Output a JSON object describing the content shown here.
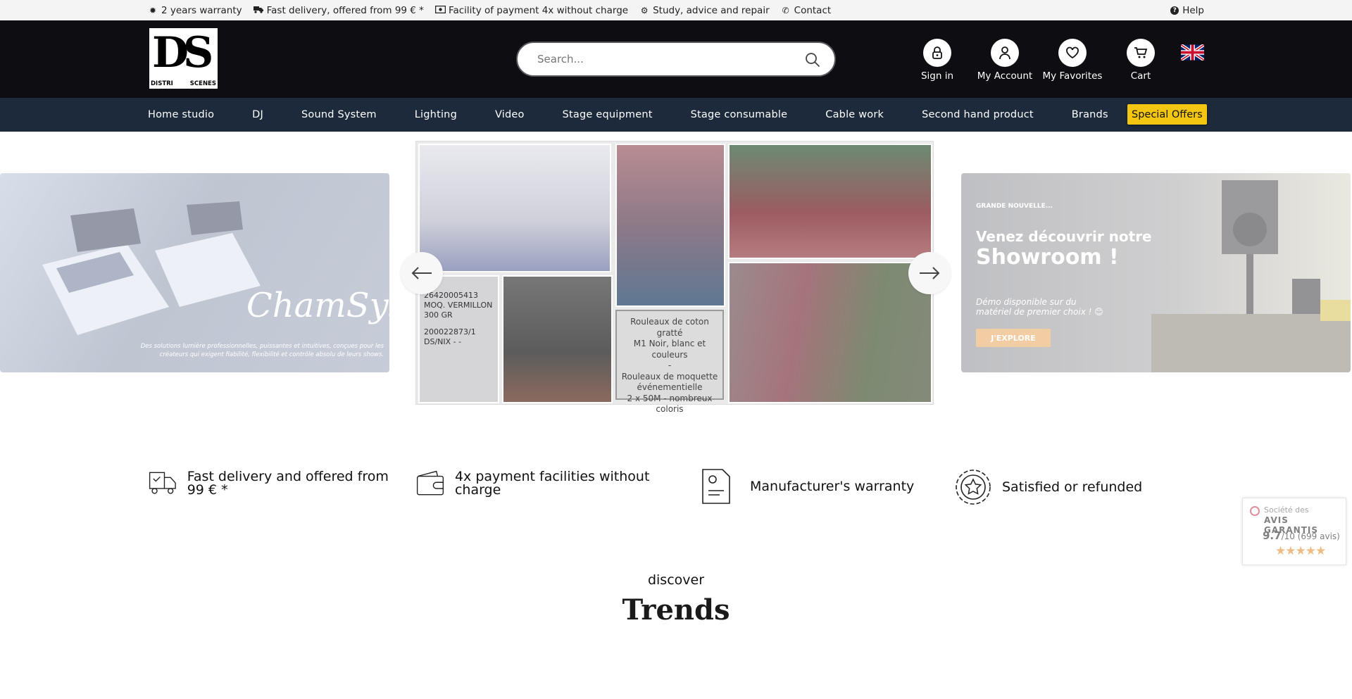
{
  "topbar": {
    "items": [
      {
        "icon": "badge-icon",
        "label": "2 years warranty"
      },
      {
        "icon": "truck-icon",
        "label": "Fast delivery, offered from 99 € *"
      },
      {
        "icon": "money-icon",
        "label": "Facility of payment 4x without charge"
      },
      {
        "icon": "gears-icon",
        "label": "Study, advice and repair"
      },
      {
        "icon": "phone-icon",
        "label": "Contact"
      }
    ],
    "help": "Help"
  },
  "header": {
    "logo": {
      "letters": "DS",
      "left": "DISTRI",
      "right": "SCENES"
    },
    "search_placeholder": "Search...",
    "icons": [
      {
        "icon": "lock-icon",
        "label": "Sign in"
      },
      {
        "icon": "user-icon",
        "label": "My Account"
      },
      {
        "icon": "heart-icon",
        "label": "My Favorites"
      },
      {
        "icon": "cart-icon",
        "label": "Cart"
      }
    ],
    "language_flag": "uk-flag-icon"
  },
  "nav": {
    "items": [
      "Home studio",
      "DJ",
      "Sound System",
      "Lighting",
      "Video",
      "Stage equipment",
      "Stage consumable",
      "Cable work",
      "Second hand product",
      "Brands"
    ],
    "special": "Special Offers",
    "special_color": "#f3c612"
  },
  "slider": {
    "left": {
      "brand": "ChamSys",
      "text": "Des solutions lumière professionnelles, puissantes et intuitives, conçues pour les créateurs qui exigent fiabilité, flexibilité et contrôle absolu de leurs shows."
    },
    "center": {
      "caption": [
        "Rouleaux de coton gratté",
        "M1 Noir, blanc et couleurs",
        "-",
        "Rouleaux de moquette",
        "événementielle",
        "2 x 50M - nombreux",
        "coloris"
      ],
      "label_lines": [
        "26420005413",
        "MOQ. VERMILLON",
        "300 GR",
        "200022873/1",
        "DS/NIX - -"
      ]
    },
    "right": {
      "kicker": "GRANDE NOUVELLE...",
      "title1": "Venez découvrir notre",
      "title2": "Showroom !",
      "subtitle": "Démo disponible sur du matériel de premier choix ! 😊",
      "button": "J'EXPLORE"
    }
  },
  "features": [
    {
      "icon": "delivery-truck-icon",
      "label": "Fast delivery and offered from 99 € *"
    },
    {
      "icon": "wallet-icon",
      "label": "4x payment facilities without charge"
    },
    {
      "icon": "warranty-document-icon",
      "label": "Manufacturer's warranty"
    },
    {
      "icon": "star-seal-icon",
      "label": "Satisfied or refunded"
    }
  ],
  "reviews": {
    "line1": "Société des",
    "line2": "AVIS GARANTIS",
    "score": "9.7",
    "scale": "/10",
    "count": "(699 avis)",
    "stars": "★★★★★"
  },
  "discover": {
    "kicker": "discover",
    "title": "Trends"
  }
}
